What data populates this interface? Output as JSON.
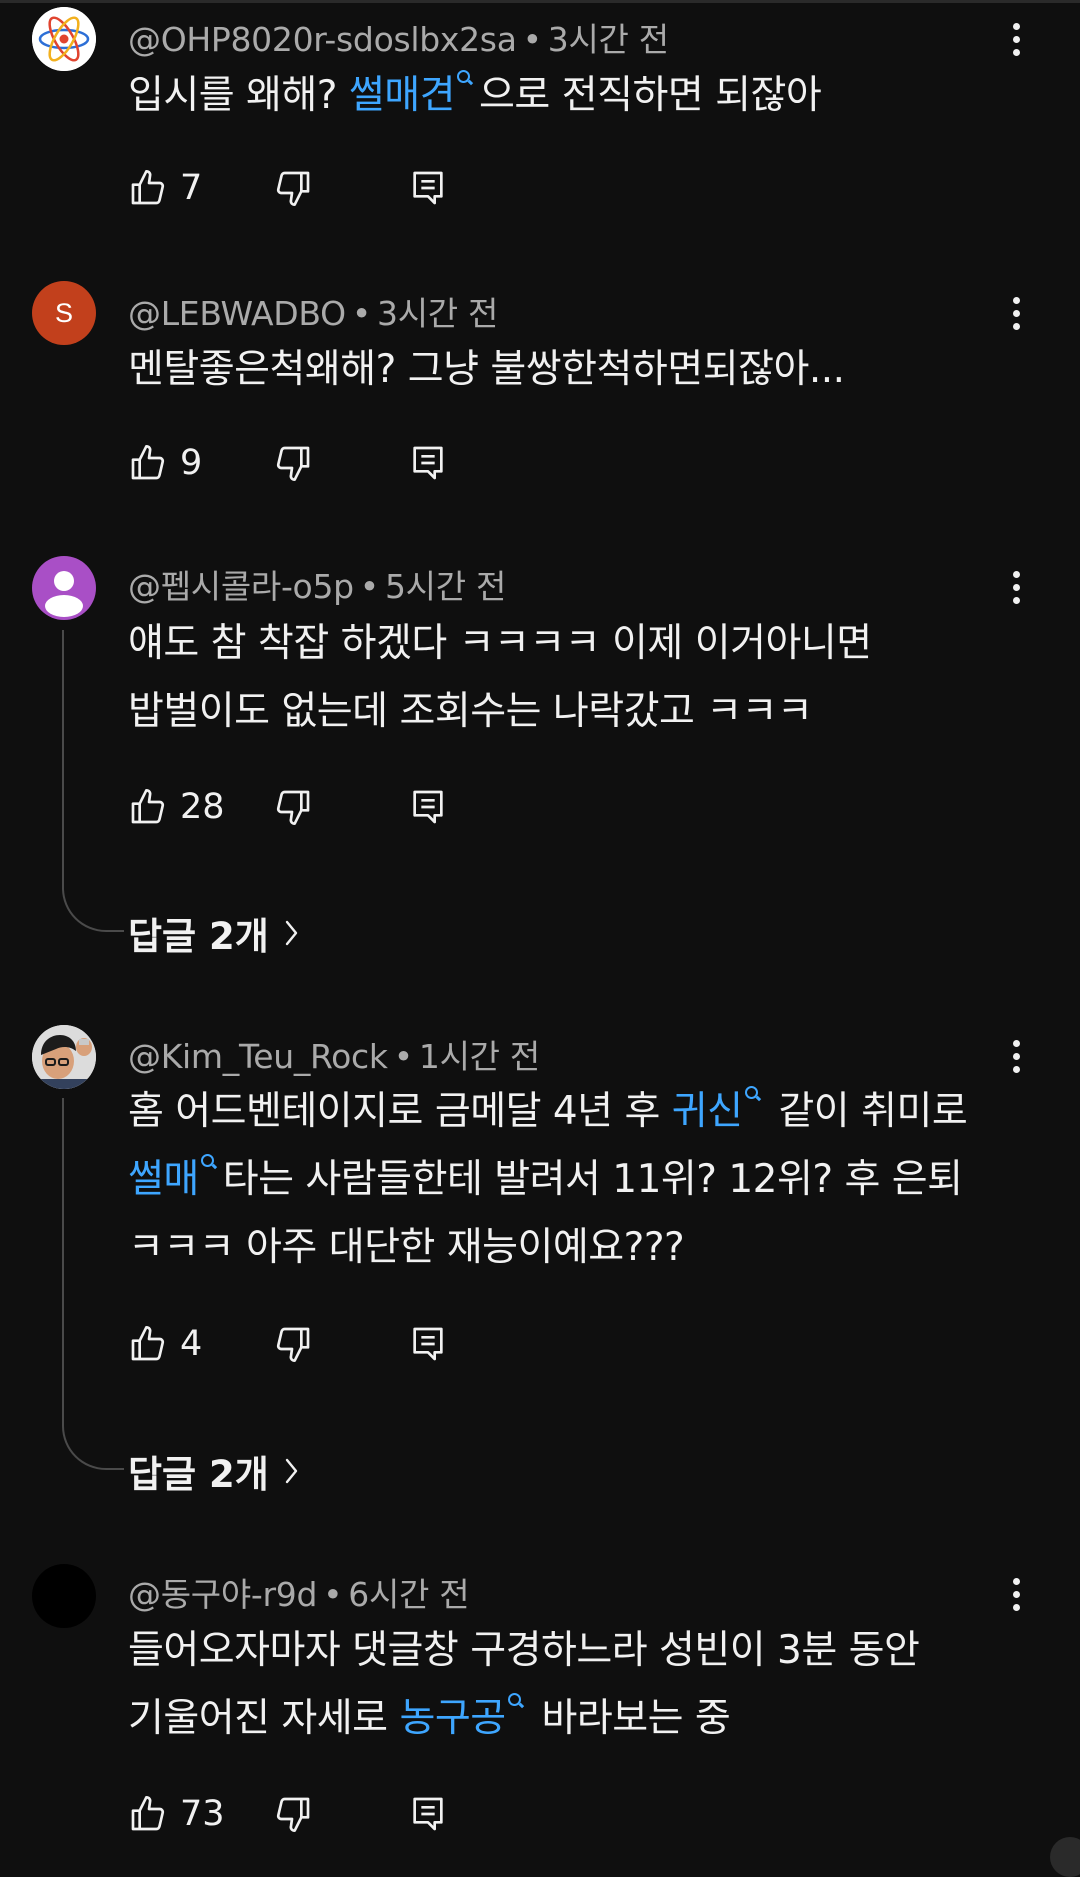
{
  "comments": [
    {
      "handle": "@OHP8020r-sdoslbx2sa",
      "time": "3시간 전",
      "text_parts": [
        "입시를 왜해? ",
        "썰매견",
        "으로 전직하면 되잖아"
      ],
      "likes": "7",
      "avatar": {
        "type": "atom-icon"
      }
    },
    {
      "handle": "@LEBWADBO",
      "time": "3시간 전",
      "text_lines": [
        "멘탈좋은척왜해? 그냥 불쌍한척하면되잖아..."
      ],
      "likes": "9",
      "avatar": {
        "type": "letter",
        "letter": "S",
        "color": "#c2401c"
      }
    },
    {
      "handle": "@펩시콜라-o5p",
      "time": "5시간 전",
      "text_lines": [
        "얘도 참 착잡 하겠다 ㅋㅋㅋㅋ 이제 이거아니면",
        "밥벌이도 없는데 조회수는 나락갔고 ㅋㅋㅋ"
      ],
      "likes": "28",
      "replies": "답글 2개",
      "avatar": {
        "type": "default-person",
        "color": "#a94fc6"
      }
    },
    {
      "handle": "@Kim_Teu_Rock",
      "time": "1시간 전",
      "line1_parts": [
        "홈 어드벤테이지로 금메달 4년 후 ",
        "귀신",
        " 같이 취미로"
      ],
      "line2_parts": [
        "썰매",
        "타는 사람들한테 발려서 11위? 12위? 후 은퇴"
      ],
      "line3": "ㅋㅋㅋ 아주 대단한 재능이예요???",
      "likes": "4",
      "replies": "답글 2개",
      "avatar": {
        "type": "photo"
      }
    },
    {
      "handle": "@동구야-r9d",
      "time": "6시간 전",
      "line1": "들어오자마자 댓글창 구경하느라 성빈이 3분 동안",
      "line2_parts": [
        "기울어진 자세로 ",
        "농구공",
        " 바라보는 중"
      ],
      "likes": "73",
      "avatar": {
        "type": "solid",
        "color": "#000000"
      }
    }
  ],
  "meta_separator": "•",
  "colors": {
    "background": "#0f0f0f",
    "text": "#f1f1f1",
    "secondary_text": "#aaaaaa",
    "link": "#3ea6ff"
  },
  "icons": {
    "like": "thumbs-up-icon",
    "dislike": "thumbs-down-icon",
    "reply": "reply-comment-icon",
    "menu": "more-vert-icon",
    "search": "search-icon",
    "chevron": "chevron-right-icon"
  }
}
